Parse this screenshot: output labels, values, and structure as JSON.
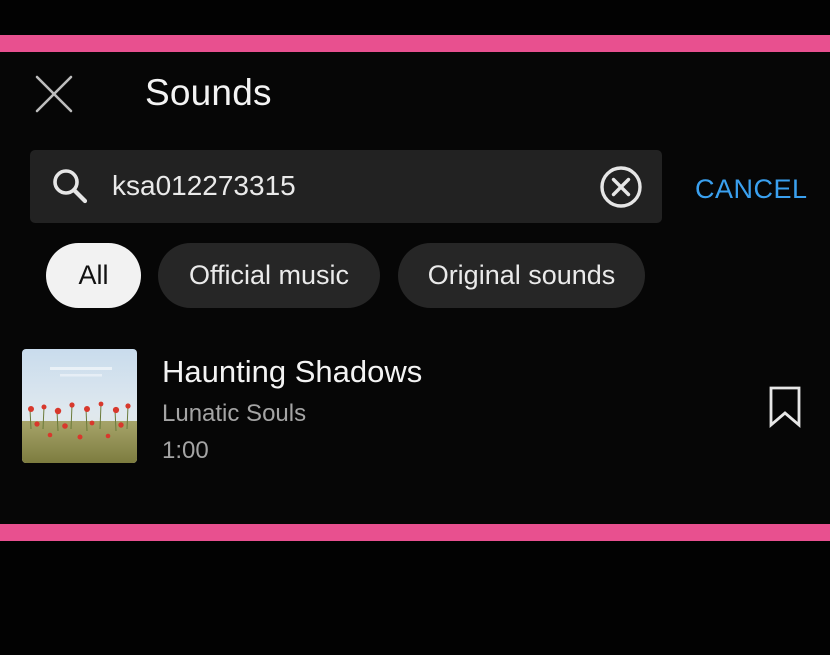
{
  "header": {
    "title": "Sounds",
    "close_icon": "close-icon"
  },
  "search": {
    "value": "ksa012273315",
    "search_icon": "search-icon",
    "clear_icon": "clear-circle-icon",
    "cancel_label": "CANCEL"
  },
  "filters": [
    {
      "label": "All",
      "selected": true
    },
    {
      "label": "Official music",
      "selected": false
    },
    {
      "label": "Original sounds",
      "selected": false
    }
  ],
  "results": [
    {
      "title": "Haunting Shadows",
      "artist": "Lunatic Souls",
      "duration": "1:00",
      "bookmark_icon": "bookmark-icon"
    }
  ],
  "colors": {
    "accent_pink": "#e8508f",
    "cancel_blue": "#3aa0ef",
    "background": "#060606",
    "chip_bg": "#262626",
    "search_bg": "#222222"
  }
}
